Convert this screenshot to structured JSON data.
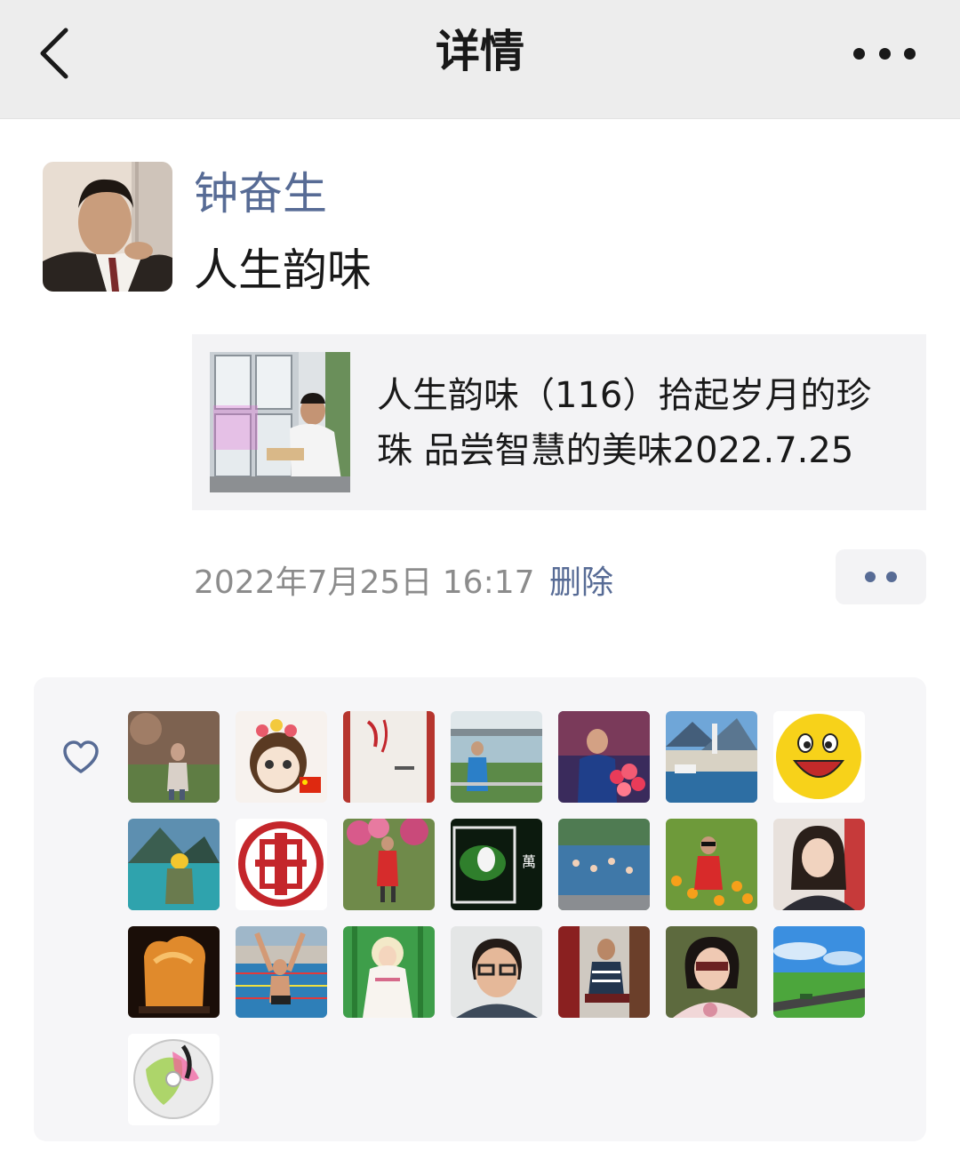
{
  "header": {
    "title": "详情",
    "back_icon": "chevron-left-icon",
    "more_icon": "more-dots-icon"
  },
  "post": {
    "author": "钟奋生",
    "text": "人生韵味",
    "link_card": {
      "title": "人生韵味（116）拾起岁月的珍珠 品尝智慧的美味2022.7.25"
    },
    "timestamp": "2022年7月25日 16:17",
    "delete_label": "删除",
    "action_icon": "two-dots-icon"
  },
  "likes": {
    "icon": "heart-outline-icon",
    "count": 22,
    "avatar_images": [
      "woman-sitting-on-rocks",
      "cartoon-girl-with-flowers-and-flag",
      "calligraphy-book-cover",
      "woman-by-river-bridge",
      "man-speaking-with-roses",
      "lakeside-village-church",
      "yellow-smiley-face",
      "hiker-by-mountain-lake",
      "red-seal-stamp",
      "woman-in-red-among-blossoms",
      "white-flower-on-green",
      "swimmers-in-pool",
      "woman-in-flower-field",
      "woman-portrait-indoors",
      "amber-stone-carving",
      "swimmer-arms-raised",
      "guanyin-painting",
      "man-with-glasses",
      "man-seated-on-chair",
      "woman-with-sunglasses",
      "green-road-landscape",
      "cd-disc"
    ]
  }
}
